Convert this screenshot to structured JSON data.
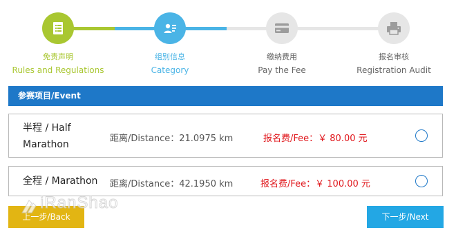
{
  "steps": [
    {
      "cn": "免责声明",
      "en": "Rules and Regulations",
      "icon": "document-icon",
      "color": "#a9c731"
    },
    {
      "cn": "组别信息",
      "en": "Category",
      "icon": "id-card-icon",
      "color": "#4ab4e6"
    },
    {
      "cn": "缴纳费用",
      "en": "Pay the Fee",
      "icon": "credit-card-icon",
      "color": "#666666"
    },
    {
      "cn": "报名审核",
      "en": "Registration Audit",
      "icon": "printer-icon",
      "color": "#666666"
    }
  ],
  "section": {
    "title": "参赛项目/Event",
    "color": "#1e78c8"
  },
  "events": [
    {
      "name": "半程 / Half Marathon",
      "distance": "距离/Distance：21.0975 km",
      "fee": "报名费/Fee：￥ 80.00 元",
      "selected": false
    },
    {
      "name": "全程 / Marathon",
      "distance": "距离/Distance：42.1950 km",
      "fee": "报名费/Fee：￥ 100.00 元",
      "selected": false
    }
  ],
  "buttons": {
    "back": "上一步/Back",
    "next": "下一步/Next"
  },
  "watermark": {
    "text": "iRanShao"
  }
}
